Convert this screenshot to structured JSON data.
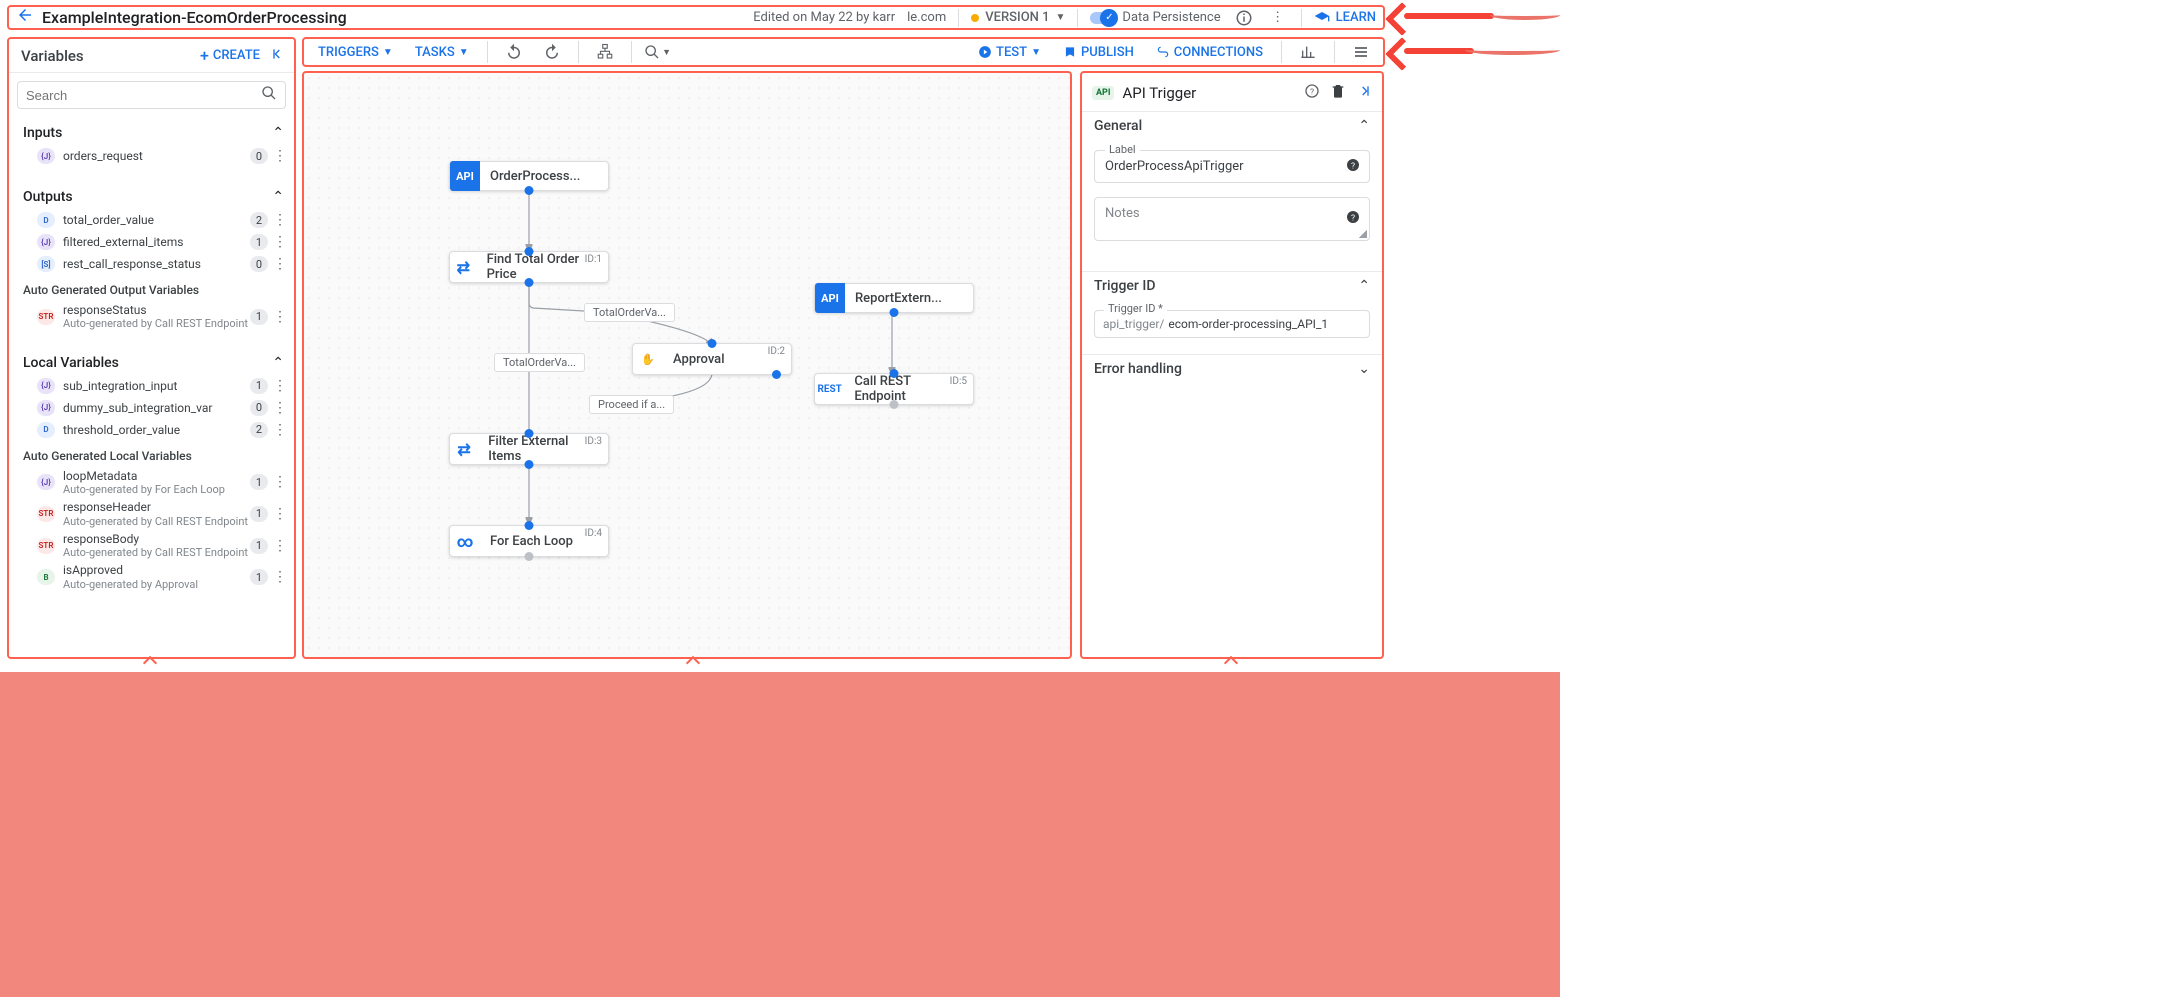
{
  "header": {
    "title": "ExampleIntegration-EcomOrderProcessing",
    "edited": "Edited on May 22 by karr",
    "domain": "le.com",
    "version": "VERSION 1",
    "persistence": "Data Persistence",
    "learn": "LEARN"
  },
  "canvasBar": {
    "triggers": "TRIGGERS",
    "tasks": "TASKS",
    "test": "TEST",
    "publish": "PUBLISH",
    "connections": "CONNECTIONS"
  },
  "vars": {
    "title": "Variables",
    "create": "CREATE",
    "searchPh": "Search",
    "inputs": "Inputs",
    "outputs": "Outputs",
    "locals": "Local Variables",
    "autoOut": "Auto Generated Output Variables",
    "autoLoc": "Auto Generated Local Variables",
    "rows": {
      "in1": {
        "name": "orders_request",
        "count": "0"
      },
      "out1": {
        "name": "total_order_value",
        "count": "2"
      },
      "out2": {
        "name": "filtered_external_items",
        "count": "1"
      },
      "out3": {
        "name": "rest_call_response_status",
        "count": "0"
      },
      "aoo1": {
        "name": "responseStatus",
        "sub": "Auto-generated by Call REST Endpoint",
        "count": "1"
      },
      "loc1": {
        "name": "sub_integration_input",
        "count": "1"
      },
      "loc2": {
        "name": "dummy_sub_integration_var",
        "count": "0"
      },
      "loc3": {
        "name": "threshold_order_value",
        "count": "2"
      },
      "agl1": {
        "name": "loopMetadata",
        "sub": "Auto-generated by For Each Loop",
        "count": "1"
      },
      "agl2": {
        "name": "responseHeader",
        "sub": "Auto-generated by Call REST Endpoint",
        "count": "1"
      },
      "agl3": {
        "name": "responseBody",
        "sub": "Auto-generated by Call REST Endpoint",
        "count": "1"
      },
      "agl4": {
        "name": "isApproved",
        "sub": "Auto-generated by Approval",
        "count": "1"
      }
    }
  },
  "nodes": {
    "n_trigger1": "OrderProcess...",
    "n_find": "Find Total Order Price",
    "n_approval": "Approval",
    "n_filter": "Filter External Items",
    "n_loop": "For Each Loop",
    "n_trigger2": "ReportExtern...",
    "n_rest": "Call REST Endpoint",
    "id1": "ID:1",
    "id2": "ID:2",
    "id3": "ID:3",
    "id4": "ID:4",
    "id5": "ID:5",
    "e_total": "TotalOrderVa...",
    "e_total2": "TotalOrderVa...",
    "e_proceed": "Proceed if a..."
  },
  "right": {
    "title": "API Trigger",
    "general": "General",
    "labelLbl": "Label",
    "labelVal": "OrderProcessApiTrigger",
    "notesLbl": "Notes",
    "notesPh": "",
    "tidSection": "Trigger ID",
    "tidLbl": "Trigger ID *",
    "tidPrefix": "api_trigger/",
    "tidVal": "ecom-order-processing_API_1",
    "errHandling": "Error handling"
  }
}
